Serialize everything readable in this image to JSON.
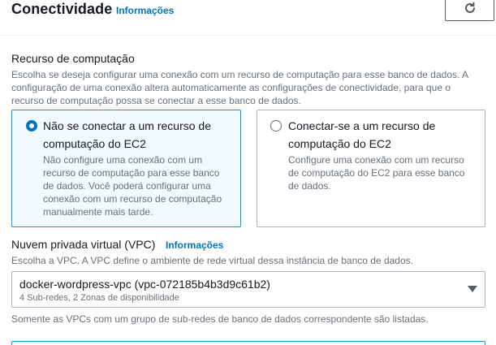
{
  "header": {
    "title": "Conectividade",
    "info_link": "Informações",
    "refresh_icon": "refresh-icon"
  },
  "compute": {
    "label": "Recurso de computação",
    "description": "Escolha se deseja configurar uma conexão com um recurso de computação para esse banco de dados. A configuração de uma conexão altera automaticamente as configurações de conectividade, para que o recurso de computação possa se conectar a esse banco de dados.",
    "options": [
      {
        "title_line1": "Não se conectar a um recurso de",
        "title_line2": "computação do EC2",
        "desc_line1": "Não configure uma conexão com um",
        "desc_line2": "recurso de computação para esse banco",
        "desc_line3": "de dados. Você poderá configurar uma",
        "desc_line4": "conexão com um recurso de computação",
        "desc_line5": "manualmente mais tarde.",
        "selected": true
      },
      {
        "title_line1": "Conectar-se a um recurso de",
        "title_line2": "computação do EC2",
        "desc_line1": "Configure uma conexão com um recurso",
        "desc_line2": "de computação do EC2 para esse banco",
        "desc_line3": "de dados.",
        "selected": false
      }
    ]
  },
  "vpc": {
    "label": "Nuvem privada virtual (VPC)",
    "info_link": "Informações",
    "description": "Escolha a VPC. A VPC define o ambiente de rede virtual dessa instância de banco de dados.",
    "selected_value": "docker-wordpress-vpc (vpc-072185b4b3d9c61b2)",
    "selected_sub": "4 Sub-redes, 2 Zonas de disponibilidade",
    "hint": "Somente as VPCs com um grupo de sub-redes de banco de dados correspondente são listadas."
  },
  "colors": {
    "link": "#0073bb",
    "selected_border": "#00a1c9",
    "selected_bg": "#f1faff"
  }
}
